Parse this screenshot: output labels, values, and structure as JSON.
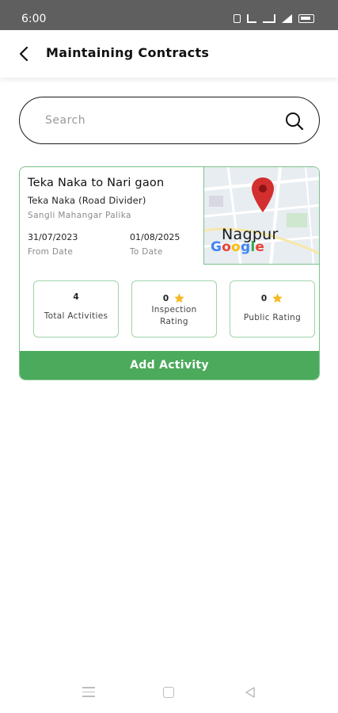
{
  "status_bar": {
    "time": "6:00"
  },
  "header": {
    "title": "Maintaining Contracts"
  },
  "search": {
    "placeholder": "Search",
    "value": ""
  },
  "contract": {
    "title": "Teka Naka to Nari gaon",
    "subtitle": "Teka Naka (Road Divider)",
    "authority": "Sangli Mahangar Palika",
    "from_date": "31/07/2023",
    "from_label": "From Date",
    "to_date": "01/08/2025",
    "to_label": "To Date",
    "map": {
      "city": "Nagpur",
      "brand": [
        "G",
        "o",
        "o",
        "g",
        "l",
        "e"
      ],
      "brand_colors": [
        "#4285F4",
        "#EA4335",
        "#FBBC05",
        "#4285F4",
        "#34A853",
        "#EA4335"
      ],
      "pin_color": "#d32f2f"
    },
    "stats": [
      {
        "value": "4",
        "label": "Total Activities",
        "icon": ""
      },
      {
        "value": "0",
        "label": "Inspection Rating",
        "icon": "star-icon"
      },
      {
        "value": "0",
        "label": "Public Rating",
        "icon": "star-icon"
      }
    ],
    "add_activity_label": "Add Activity"
  },
  "colors": {
    "accent": "#4caa5c",
    "card_border": "#7bc28a",
    "star": "#f5b921"
  }
}
